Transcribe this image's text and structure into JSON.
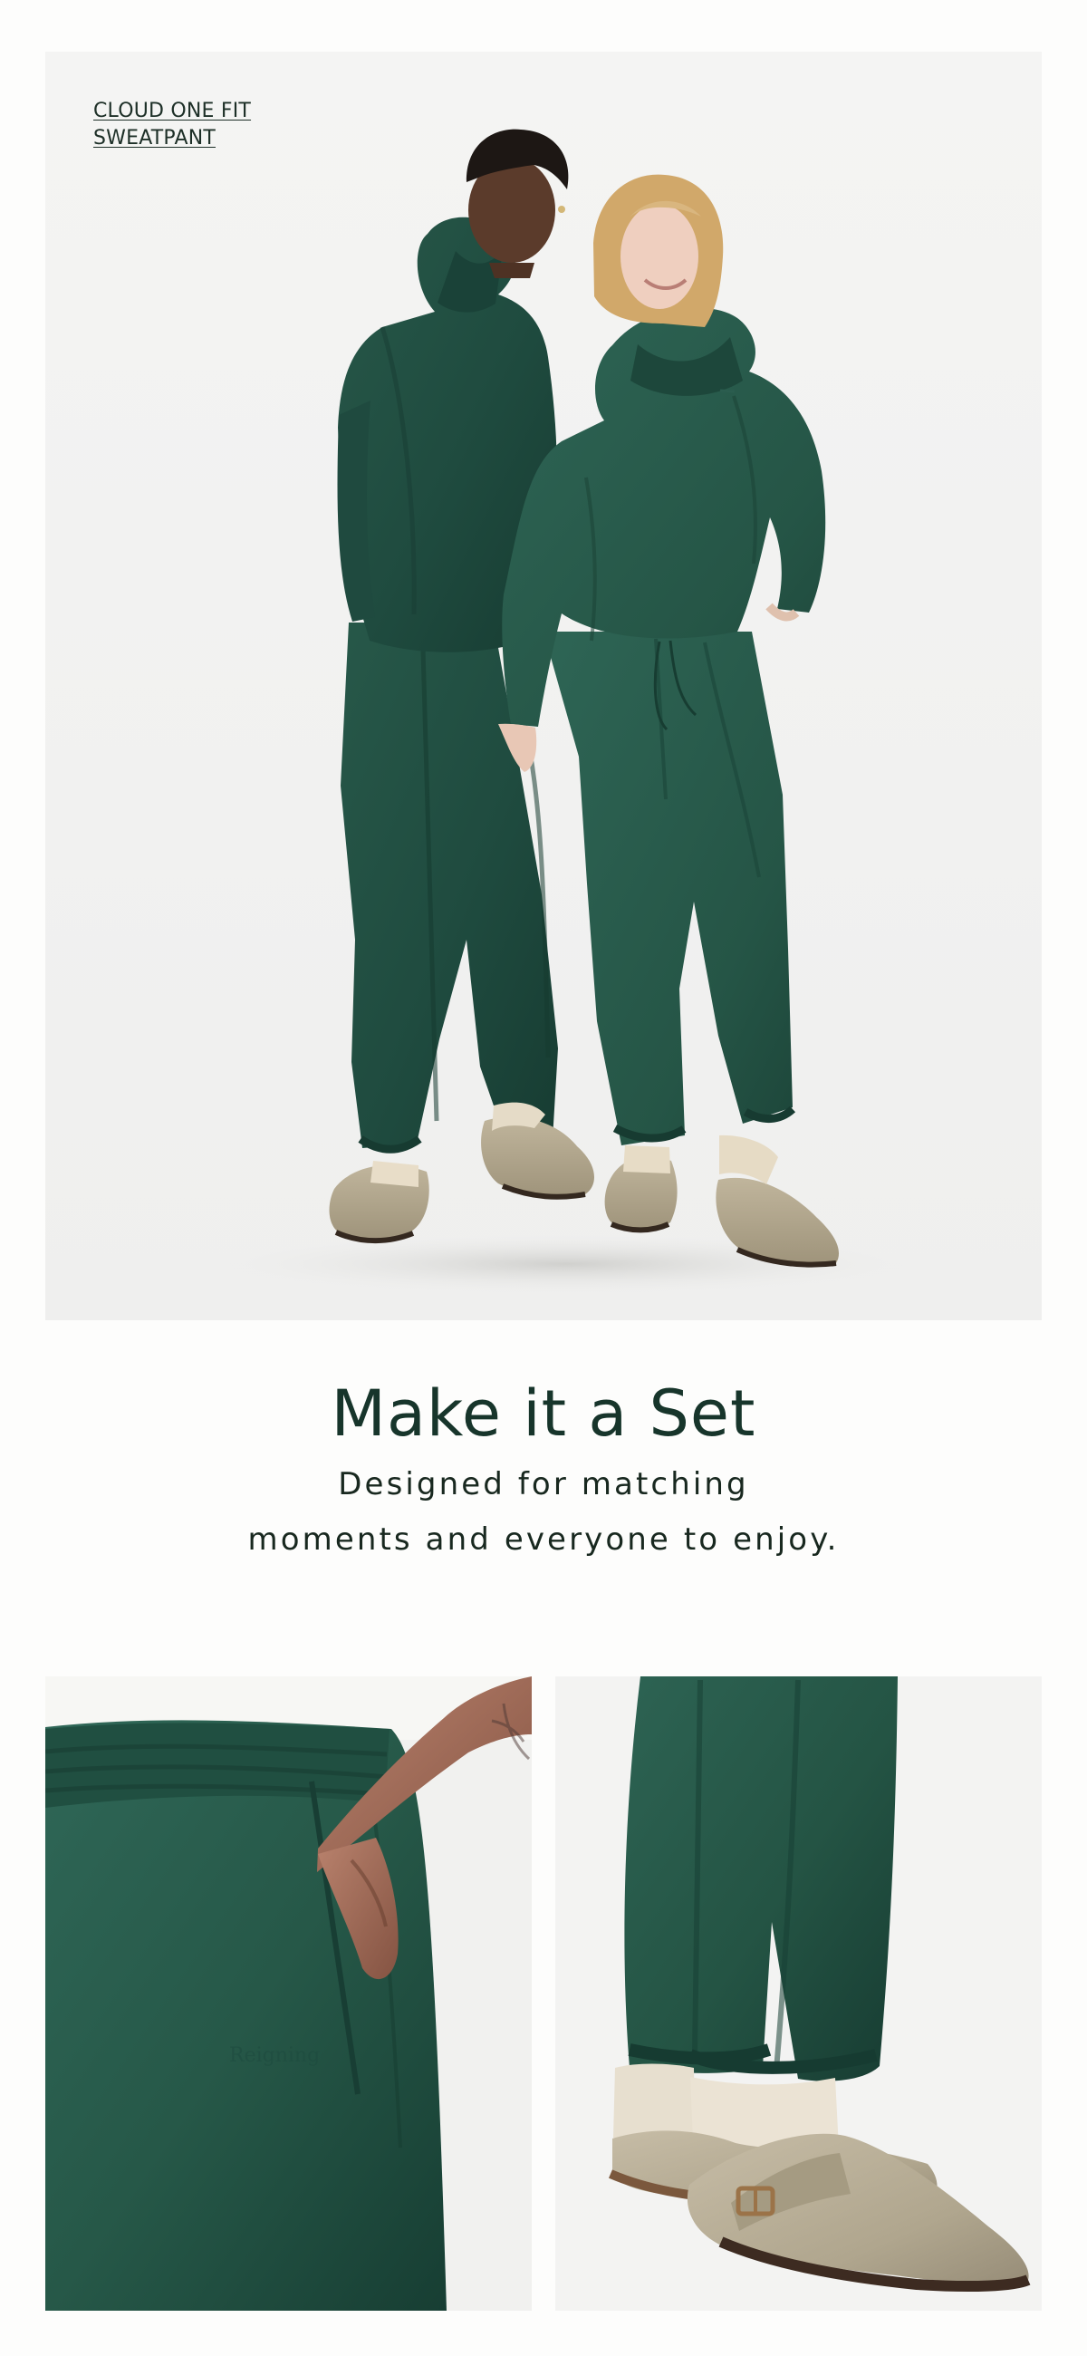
{
  "hero": {
    "product_link_line1": "CLOUD ONE FIT",
    "product_link_line2": "SWEATPANT"
  },
  "set_section": {
    "title": "Make it a Set",
    "subtitle_line1": "Designed for matching",
    "subtitle_line2": "moments and everyone to enjoy."
  },
  "colors": {
    "background": "#fdfdfc",
    "photo_background": "#f2f2f1",
    "garment_green": "#234f43",
    "text_dark_green": "#17352b",
    "sandal_taupe": "#b5aa91"
  },
  "icons": []
}
